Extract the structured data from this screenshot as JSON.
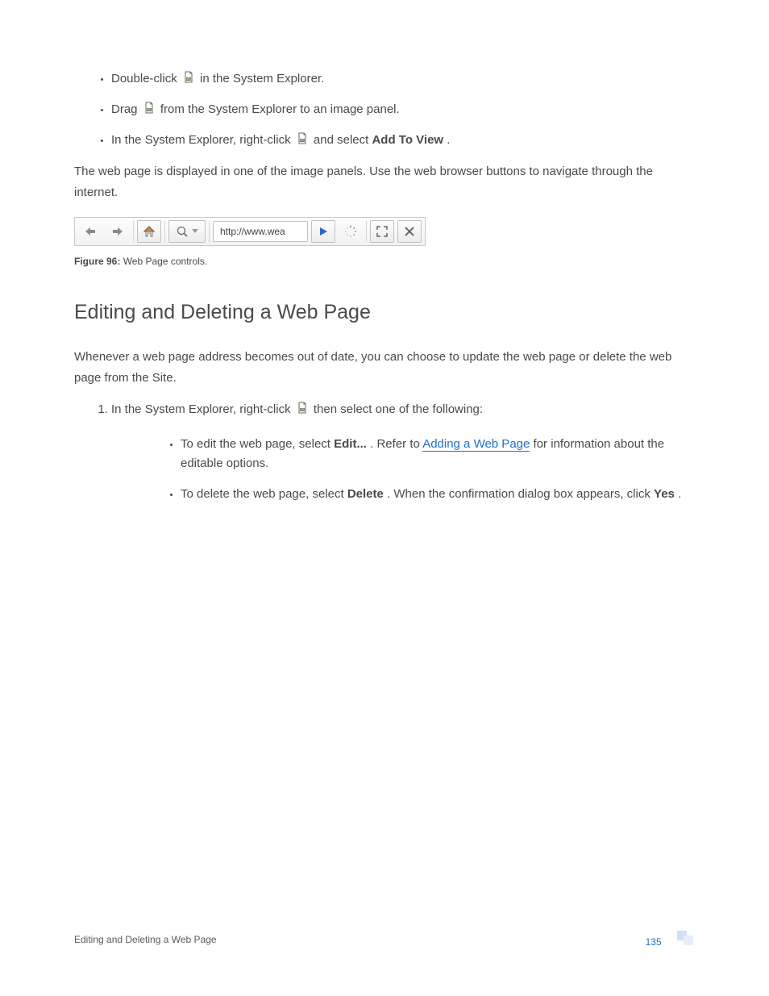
{
  "top_bullets": {
    "b1_a": "Double-click ",
    "b1_b": " in the System Explorer.",
    "b2_a": "Drag ",
    "b2_b": " from the System Explorer to an image panel.",
    "b3_a": "In the System Explorer, right-click ",
    "b3_b": " and select ",
    "b3_bold": "Add To View",
    "b3_c": "."
  },
  "para1": "The web page is displayed in one of the image panels. Use the web browser buttons to navigate through the internet.",
  "toolbar": {
    "url_text": "http://www.wea"
  },
  "caption": {
    "label": "Figure 96:",
    "text": " Web Page controls."
  },
  "heading": "Editing and Deleting a Web Page",
  "para2": "Whenever a web page address becomes out of date, you can choose to update the web page or delete the web page from the Site.",
  "step1": {
    "a": "In the System Explorer, right-click ",
    "b": " then select one of the following:"
  },
  "sub": {
    "s1_a": "To edit the web page, select ",
    "s1_bold": "Edit...",
    "s1_b": ". Refer to ",
    "s1_link": "Adding a Web Page",
    "s1_c": " for information about the editable options.",
    "s2_a": "To delete the web page, select ",
    "s2_bold": "Delete",
    "s2_b": ". When the confirmation dialog box appears, click ",
    "s2_bold2": "Yes",
    "s2_c": "."
  },
  "footer": {
    "title": "Editing and Deleting a Web Page",
    "page": "135"
  }
}
